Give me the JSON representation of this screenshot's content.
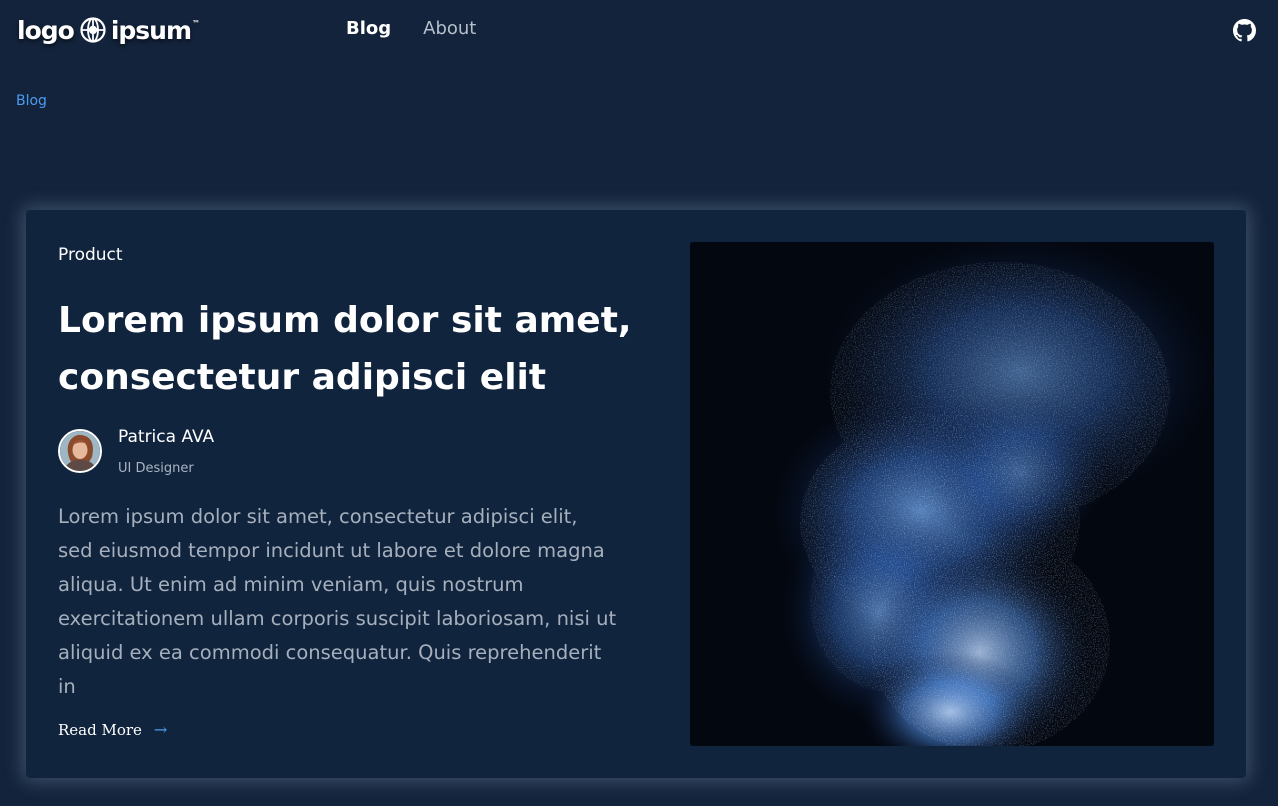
{
  "header": {
    "logo_text_left": "logo",
    "logo_text_right": "ipsum",
    "logo_icon": "globe-icon",
    "nav": [
      {
        "label": "Blog",
        "active": true
      },
      {
        "label": "About",
        "active": false
      }
    ],
    "github_icon": "github-icon"
  },
  "breadcrumb": {
    "label": "Blog"
  },
  "post": {
    "category": "Product",
    "title": "Lorem ipsum dolor sit amet, consectetur adipisci elit",
    "author": {
      "name": "Patrica AVA",
      "role": "UI Designer"
    },
    "excerpt": "Lorem ipsum dolor sit amet, consectetur adipisci elit, sed eiusmod tempor incidunt ut labore et dolore magna aliqua. Ut enim ad minim veniam, quis nostrum exercitationem ullam corporis suscipit laboriosam, nisi ut aliquid ex ea commodi consequatur. Quis reprehenderit in",
    "read_more": "Read More",
    "read_more_icon": "arrow-right-icon"
  },
  "colors": {
    "background": "#13233b",
    "card": "#11243d",
    "accent": "#4a9cf0",
    "muted_text": "#a6afbc"
  }
}
